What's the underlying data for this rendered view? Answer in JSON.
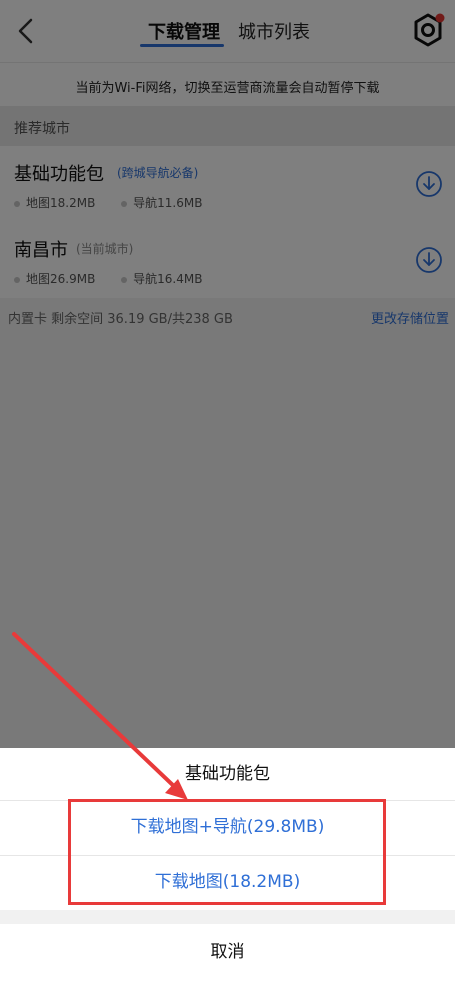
{
  "header": {
    "tabs": [
      {
        "label": "下载管理",
        "active": true
      },
      {
        "label": "城市列表",
        "active": false
      }
    ]
  },
  "notice": {
    "text": "当前为Wi-Fi网络，切换至运营商流量会自动暂停下载"
  },
  "section": {
    "title": "推荐城市"
  },
  "items": [
    {
      "name": "基础功能包",
      "tag": "(跨城导航必备)",
      "map": "地图18.2MB",
      "nav": "导航11.6MB"
    },
    {
      "name": "南昌市",
      "tag": "(当前城市)",
      "map": "地图26.9MB",
      "nav": "导航16.4MB"
    }
  ],
  "storage": {
    "text": "内置卡 剩余空间 36.19 GB/共238 GB",
    "link": "更改存储位置"
  },
  "sheet": {
    "title": "基础功能包",
    "options": [
      {
        "label": "下载地图+导航(29.8MB)"
      },
      {
        "label": "下载地图(18.2MB)"
      }
    ],
    "cancel": "取消"
  },
  "colors": {
    "accent": "#2f6fd6",
    "annotation": "#e83a3a",
    "badge": "#e53935"
  },
  "icons": [
    "back-icon",
    "settings-icon",
    "download-icon"
  ]
}
